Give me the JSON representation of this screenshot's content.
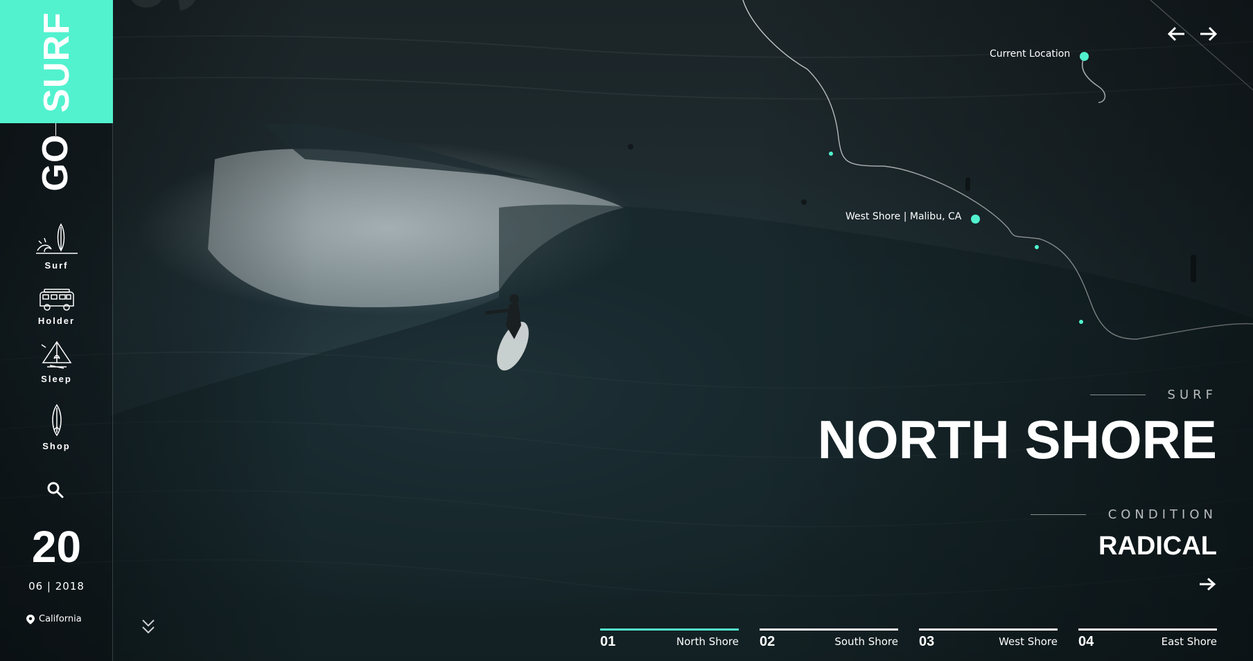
{
  "brand": {
    "line1": "SURF",
    "line2": "GO",
    "ghost": "SURF"
  },
  "nav": [
    {
      "label": "Surf",
      "icon": "surfboard-wave-icon"
    },
    {
      "label": "Holder",
      "icon": "van-icon"
    },
    {
      "label": "Sleep",
      "icon": "tent-campfire-icon"
    },
    {
      "label": "Shop",
      "icon": "surfboard-icon"
    }
  ],
  "search": {
    "icon": "search-icon"
  },
  "date": {
    "day": "20",
    "month_year": "06 | 2018"
  },
  "location": {
    "label": "California",
    "icon": "map-pin-icon"
  },
  "map": {
    "current_location": "Current Location",
    "spot_label": "West Shore | Malibu, CA"
  },
  "hero": {
    "kicker": "SURF",
    "title": "NORTH SHORE",
    "condition_label": "CONDITION",
    "condition_value": "RADICAL"
  },
  "tabs": [
    {
      "num": "01",
      "name": "North Shore",
      "active": true
    },
    {
      "num": "02",
      "name": "South Shore",
      "active": false
    },
    {
      "num": "03",
      "name": "West Shore",
      "active": false
    },
    {
      "num": "04",
      "name": "East Shore",
      "active": false
    }
  ],
  "colors": {
    "accent": "#52f2cf",
    "background": "#0e1518",
    "text": "#ffffff"
  }
}
